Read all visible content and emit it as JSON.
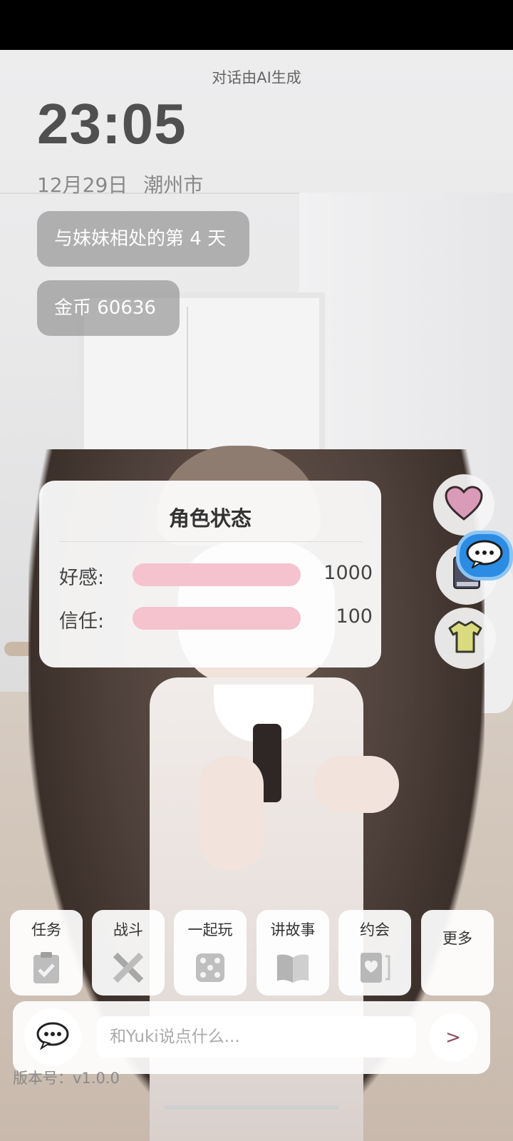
{
  "header": {
    "ai_note": "对话由AI生成",
    "time": "23:05",
    "date": "12月29日",
    "location": "潮州市"
  },
  "info_pills": {
    "days_together": "与妹妹相处的第 4 天",
    "gold": "金币 60636"
  },
  "status_card": {
    "title": "角色状态",
    "stats": [
      {
        "label": "好感:",
        "value": "1000",
        "fill_fraction": 1.0
      },
      {
        "label": "信任:",
        "value": "100",
        "fill_fraction": 1.0
      }
    ]
  },
  "side_buttons": [
    {
      "icon": "heart-icon",
      "color": "#d99bb8"
    },
    {
      "icon": "book-icon",
      "color": "#4d4f63"
    },
    {
      "icon": "shirt-icon",
      "color": "#dadb7f"
    }
  ],
  "actions": [
    {
      "label": "任务",
      "icon": "clipboard-check-icon"
    },
    {
      "label": "战斗",
      "icon": "crossed-swords-icon"
    },
    {
      "label": "一起玩",
      "icon": "dice-icon"
    },
    {
      "label": "讲故事",
      "icon": "open-book-icon"
    },
    {
      "label": "约会",
      "icon": "heart-card-icon"
    },
    {
      "label": "更多",
      "icon": ""
    }
  ],
  "chat": {
    "placeholder": "和Yuki说点什么...",
    "send_label": ">"
  },
  "version_text": "版本号：v1.0.0",
  "colors": {
    "accent_pink": "#f4c3cd",
    "chat_blue": "#2c8ce4",
    "send_arrow": "#8a4c63"
  }
}
